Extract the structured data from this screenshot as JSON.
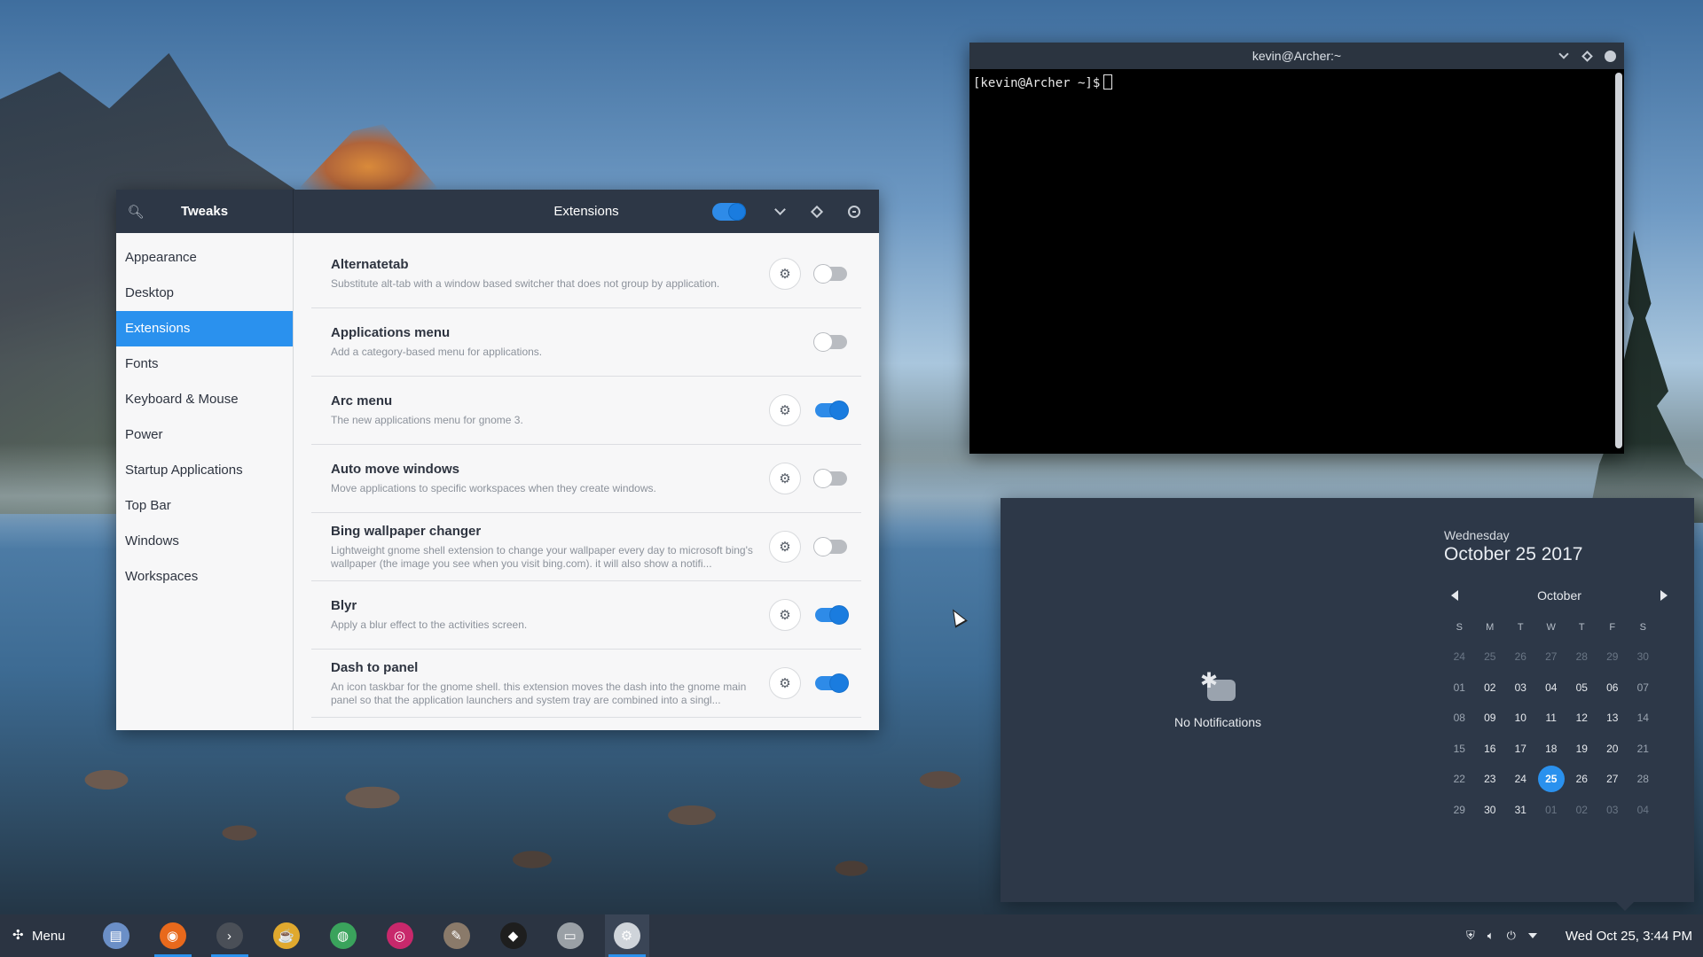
{
  "tweaks": {
    "app_title": "Tweaks",
    "page_title": "Extensions",
    "header_switch_on": true,
    "sidebar": [
      {
        "label": "Appearance",
        "active": false
      },
      {
        "label": "Desktop",
        "active": false
      },
      {
        "label": "Extensions",
        "active": true
      },
      {
        "label": "Fonts",
        "active": false
      },
      {
        "label": "Keyboard & Mouse",
        "active": false
      },
      {
        "label": "Power",
        "active": false
      },
      {
        "label": "Startup Applications",
        "active": false
      },
      {
        "label": "Top Bar",
        "active": false
      },
      {
        "label": "Windows",
        "active": false
      },
      {
        "label": "Workspaces",
        "active": false
      }
    ],
    "extensions": [
      {
        "name": "Alternatetab",
        "desc": "Substitute alt-tab with a window based switcher that does not group by application.",
        "has_settings": true,
        "enabled": false
      },
      {
        "name": "Applications menu",
        "desc": "Add a category-based menu for applications.",
        "has_settings": false,
        "enabled": false
      },
      {
        "name": "Arc menu",
        "desc": "The new applications menu for gnome 3.",
        "has_settings": true,
        "enabled": true
      },
      {
        "name": "Auto move windows",
        "desc": "Move applications to specific workspaces when they create windows.",
        "has_settings": true,
        "enabled": false
      },
      {
        "name": "Bing wallpaper changer",
        "desc": "Lightweight gnome shell extension to change your wallpaper every day to microsoft bing's wallpaper (the image you see when you visit bing.com). it will also show a notifi...",
        "has_settings": true,
        "enabled": false
      },
      {
        "name": "Blyr",
        "desc": "Apply a blur effect to the activities screen.",
        "has_settings": true,
        "enabled": true
      },
      {
        "name": "Dash to panel",
        "desc": "An icon taskbar for the gnome shell. this extension moves the dash into the gnome main panel so that the application launchers and system tray are combined into a singl...",
        "has_settings": true,
        "enabled": true
      }
    ]
  },
  "terminal": {
    "title": "kevin@Archer:~",
    "prompt": "[kevin@Archer ~]$"
  },
  "notifications": {
    "empty_text": "No Notifications"
  },
  "calendar": {
    "weekday": "Wednesday",
    "full_date": "October 25 2017",
    "month": "October",
    "day_headers": [
      "S",
      "M",
      "T",
      "W",
      "T",
      "F",
      "S"
    ],
    "today": "25",
    "weeks": [
      [
        "24",
        "25",
        "26",
        "27",
        "28",
        "29",
        "30"
      ],
      [
        "01",
        "02",
        "03",
        "04",
        "05",
        "06",
        "07"
      ],
      [
        "08",
        "09",
        "10",
        "11",
        "12",
        "13",
        "14"
      ],
      [
        "15",
        "16",
        "17",
        "18",
        "19",
        "20",
        "21"
      ],
      [
        "22",
        "23",
        "24",
        "25",
        "26",
        "27",
        "28"
      ],
      [
        "29",
        "30",
        "31",
        "01",
        "02",
        "03",
        "04"
      ]
    ]
  },
  "panel": {
    "menu_label": "Menu",
    "apps": [
      {
        "icon": "file-manager-icon",
        "color": "#6b8fc7",
        "running": false,
        "active": false
      },
      {
        "icon": "firefox-icon",
        "color": "#e8691c",
        "running": true,
        "active": false
      },
      {
        "icon": "terminal-icon",
        "color": "#4a4f57",
        "running": true,
        "active": false
      },
      {
        "icon": "teapot-icon",
        "color": "#e0a92e",
        "running": false,
        "active": false
      },
      {
        "icon": "web-icon",
        "color": "#3aa35c",
        "running": false,
        "active": false
      },
      {
        "icon": "music-player-icon",
        "color": "#c8286b",
        "running": false,
        "active": false
      },
      {
        "icon": "gimp-icon",
        "color": "#8a7a6a",
        "running": false,
        "active": false
      },
      {
        "icon": "inkscape-icon",
        "color": "#1e1e1e",
        "running": false,
        "active": false
      },
      {
        "icon": "scanner-icon",
        "color": "#9aa0a6",
        "running": false,
        "active": false
      },
      {
        "icon": "tweaks-icon",
        "color": "#cfd4da",
        "running": true,
        "active": true
      }
    ],
    "clock": "Wed Oct 25,  3:44 PM"
  }
}
